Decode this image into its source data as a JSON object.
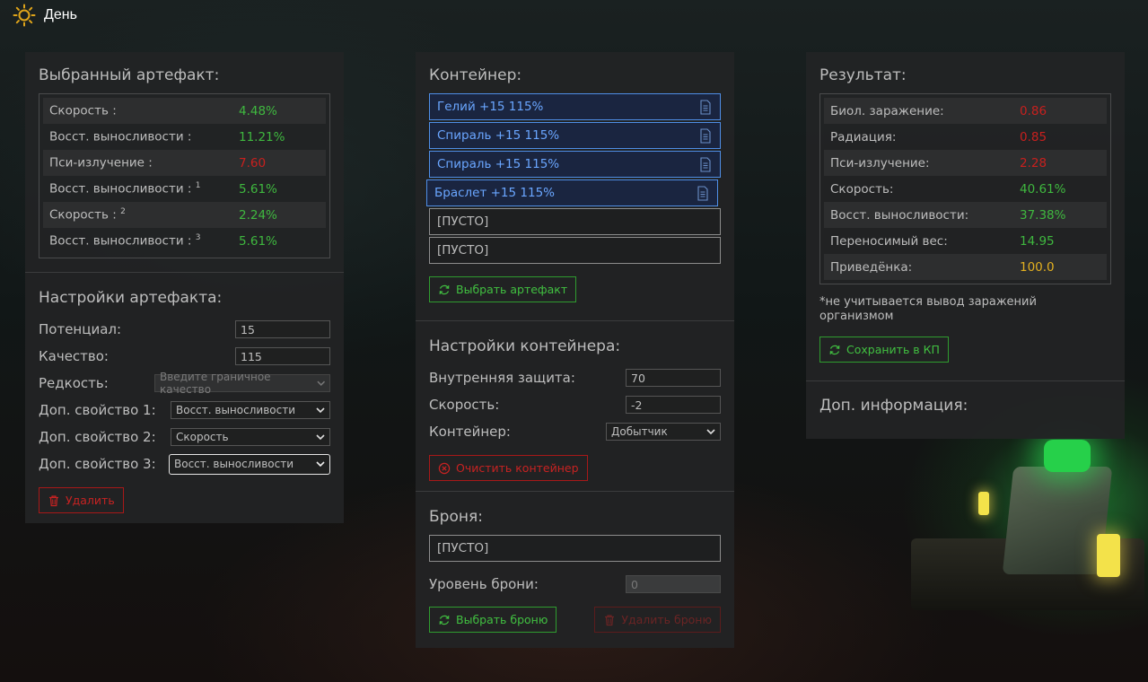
{
  "header": {
    "title": "День",
    "icon": "sun-icon"
  },
  "left": {
    "selected_title": "Выбранный артефакт:",
    "stats": [
      {
        "label": "Скорость :",
        "sup": "",
        "value": "4.48%",
        "color": "green"
      },
      {
        "label": "Восст. выносливости :",
        "sup": "",
        "value": "11.21%",
        "color": "green"
      },
      {
        "label": "Пси-излучение :",
        "sup": "",
        "value": "7.60",
        "color": "red"
      },
      {
        "label": "Восст. выносливости :",
        "sup": "1",
        "value": "5.61%",
        "color": "green"
      },
      {
        "label": "Скорость :",
        "sup": "2",
        "value": "2.24%",
        "color": "green"
      },
      {
        "label": "Восст. выносливости :",
        "sup": "3",
        "value": "5.61%",
        "color": "green"
      }
    ],
    "settings_title": "Настройки артефакта:",
    "potential_label": "Потенциал:",
    "potential_value": "15",
    "quality_label": "Качество:",
    "quality_value": "115",
    "rarity_label": "Редкость:",
    "rarity_value": "Введите граничное качество",
    "prop1_label": "Доп. свойство 1:",
    "prop1_value": "Восст. выносливости",
    "prop2_label": "Доп. свойство 2:",
    "prop2_value": "Скорость",
    "prop3_label": "Доп. свойство 3:",
    "prop3_value": "Восст. выносливости",
    "delete_label": "Удалить"
  },
  "middle": {
    "container_title": "Контейнер:",
    "slots": [
      {
        "text": "Гелий +15 115%",
        "filled": true
      },
      {
        "text": "Спираль +15 115%",
        "filled": true
      },
      {
        "text": "Спираль +15 115%",
        "filled": true
      },
      {
        "text": "Браслет +15 115%",
        "filled": true
      },
      {
        "text": "[ПУСТО]",
        "filled": false
      },
      {
        "text": "[ПУСТО]",
        "filled": false
      }
    ],
    "choose_artifact_label": "Выбрать артефакт",
    "container_settings_title": "Настройки контейнера:",
    "inner_protection_label": "Внутренняя защита:",
    "inner_protection_value": "70",
    "speed_label": "Скорость:",
    "speed_value": "-2",
    "container_label": "Контейнер:",
    "container_value": "Добытчик",
    "clear_container_label": "Очистить контейнер",
    "armor_title": "Броня:",
    "armor_slot": "[ПУСТО]",
    "armor_level_label": "Уровень брони:",
    "armor_level_value": "0",
    "choose_armor_label": "Выбрать броню",
    "delete_armor_label": "Удалить броню"
  },
  "right": {
    "result_title": "Результат:",
    "stats": [
      {
        "label": "Биол. заражение:",
        "value": "0.86",
        "color": "red"
      },
      {
        "label": "Радиация:",
        "value": "0.85",
        "color": "red"
      },
      {
        "label": "Пси-излучение:",
        "value": "2.28",
        "color": "red"
      },
      {
        "label": "Скорость:",
        "value": "40.61%",
        "color": "green"
      },
      {
        "label": "Восст. выносливости:",
        "value": "37.38%",
        "color": "green"
      },
      {
        "label": "Переносимый вес:",
        "value": "14.95",
        "color": "green"
      },
      {
        "label": "Приведёнка:",
        "value": "100.0",
        "color": "yellow"
      }
    ],
    "note": "*не учитывается вывод заражений организмом",
    "save_label": "Сохранить в КП",
    "extra_title": "Доп. информация:"
  },
  "colors": {
    "green": "#3fb83f",
    "red": "#c8201e",
    "yellow": "#e3b020",
    "accent_blue": "#4f8ee6"
  }
}
